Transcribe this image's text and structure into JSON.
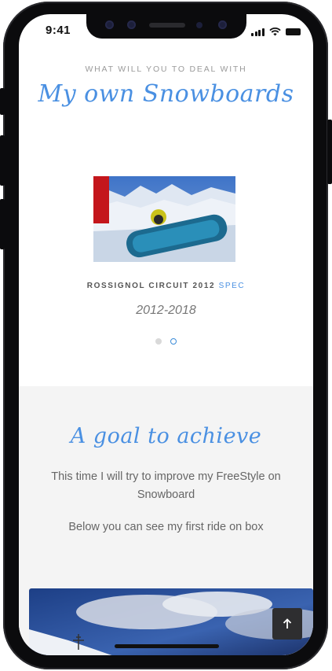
{
  "status": {
    "time": "9:41"
  },
  "section_snowboards": {
    "kicker": "WHAT WILL YOU TO DEAL WITH",
    "title": "My own Snowboards",
    "item": {
      "name": "ROSSIGNOL CIRCUIT 2012",
      "spec_link": "SPEC",
      "years": "2012-2018"
    },
    "pager": {
      "count": 2,
      "active_index": 1
    }
  },
  "section_goal": {
    "title": "A goal to achieve",
    "paragraph_1": "This time I will try to improve my FreeStyle on Snowboard",
    "paragraph_2": "Below you can see my first ride on box"
  },
  "controls": {
    "back_to_top_icon": "arrow-up-icon"
  },
  "colors": {
    "accent": "#4a90e2",
    "goal_background": "#f4f4f4",
    "device_frame": "#0b0b0d"
  }
}
